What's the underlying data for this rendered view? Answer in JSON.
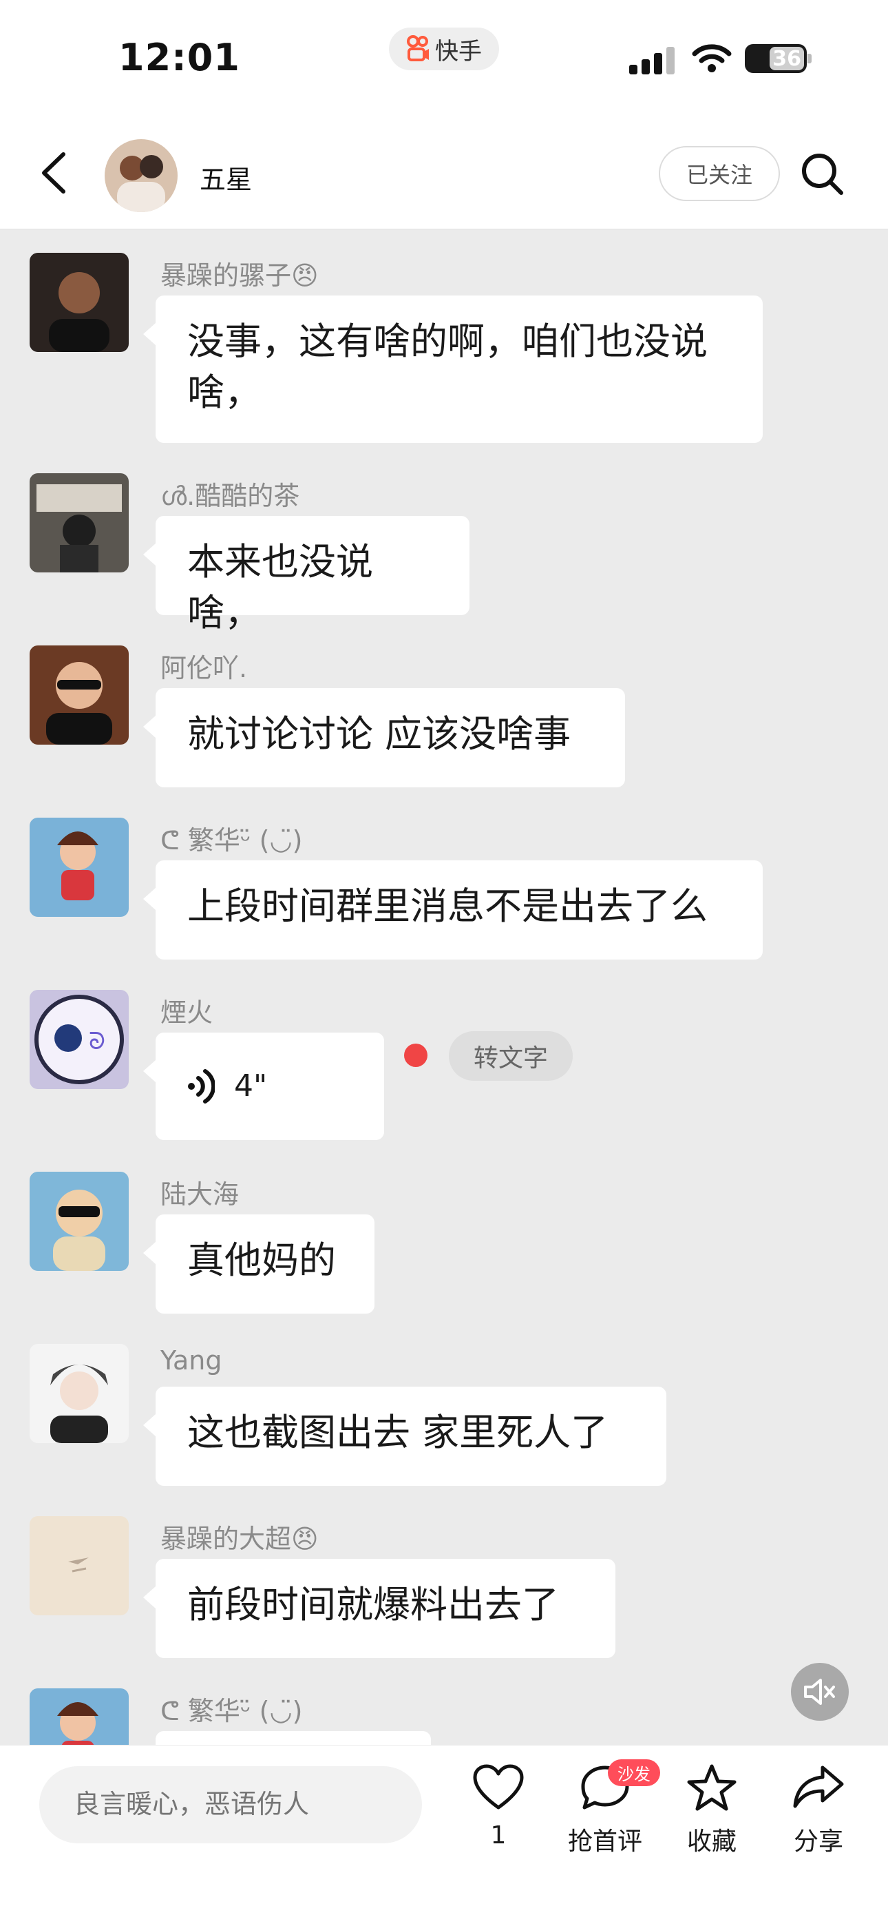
{
  "status_bar": {
    "time": "12:01",
    "app_name": "快手",
    "battery": "36"
  },
  "header": {
    "title": "五星",
    "follow_label": "已关注"
  },
  "messages": [
    {
      "sender": "暴躁的骡子😠",
      "text": "没事，这有啥的啊，咱们也没说啥，",
      "avatar_color": "#2b2320"
    },
    {
      "sender": "ൾ.酷酷的茶",
      "text": "本来也没说啥，",
      "avatar_color": "#5a5650"
    },
    {
      "sender": "阿伦吖.",
      "text": "就讨论讨论 应该没啥事",
      "avatar_color": "#6b3a24"
    },
    {
      "sender": "ᕦ 繁华ᵕ̈ (◡̈)",
      "text": "上段时间群里消息不是出去了么",
      "avatar_color": "#7ab2d8"
    },
    {
      "sender": "煙火",
      "voice_duration": "4\"",
      "convert_label": "转文字",
      "avatar_color": "#c9c3e0"
    },
    {
      "sender": "陆大海",
      "text": "真他妈的",
      "avatar_color": "#7fb7d9"
    },
    {
      "sender": "Yang",
      "text": "这也截图出去 家里死人了",
      "avatar_color": "#444444"
    },
    {
      "sender": "暴躁的大超😠",
      "text": "前段时间就爆料出去了",
      "avatar_color": "#efe3d2"
    },
    {
      "sender": "ᕦ 繁华ᵕ̈ (◡̈)",
      "avatar_color": "#7ab2d8"
    }
  ],
  "bottom_bar": {
    "comment_placeholder": "良言暖心，恶语伤人",
    "like_count": "1",
    "comment_label": "抢首评",
    "sofa_badge": "沙发",
    "favorite_label": "收藏",
    "share_label": "分享"
  },
  "colors": {
    "accent": "#ff4d5a",
    "bubble": "#ffffff",
    "chat_bg": "#ebebeb"
  }
}
